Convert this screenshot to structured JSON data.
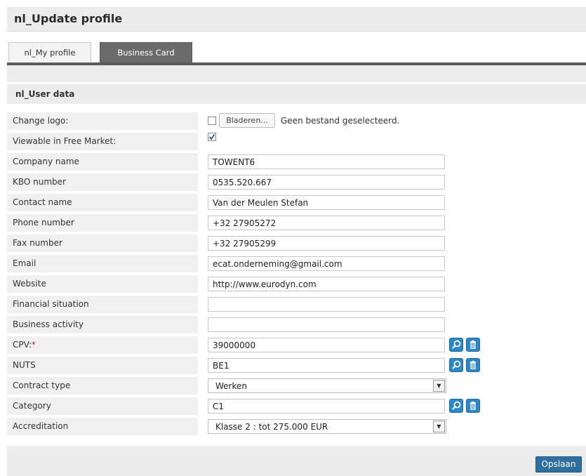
{
  "page": {
    "title": "nl_Update profile"
  },
  "tabs": [
    {
      "label": "nl_My profile"
    },
    {
      "label": "Business Card"
    }
  ],
  "section": {
    "title": "nl_User data"
  },
  "form": {
    "change_logo": {
      "label": "Change logo:",
      "browse_label": "Bladeren...",
      "no_file_text": "Geen bestand geselecteerd."
    },
    "viewable": {
      "label": "Viewable in Free Market:",
      "checked": true
    },
    "company_name": {
      "label": "Company name",
      "value": "TOWENT6"
    },
    "kbo_number": {
      "label": "KBO number",
      "value": "0535.520.667"
    },
    "contact_name": {
      "label": "Contact name",
      "value": "Van der Meulen Stefan"
    },
    "phone_number": {
      "label": "Phone number",
      "value": "+32 27905272"
    },
    "fax_number": {
      "label": "Fax number",
      "value": "+32 27905299"
    },
    "email": {
      "label": "Email",
      "value": "ecat.onderneming@gmail.com"
    },
    "website": {
      "label": "Website",
      "value": "http://www.eurodyn.com"
    },
    "financial_situation": {
      "label": "Financial situation",
      "value": ""
    },
    "business_activity": {
      "label": "Business activity",
      "value": ""
    },
    "cpv": {
      "label": "CPV:",
      "required_mark": "*",
      "value": "39000000"
    },
    "nuts": {
      "label": "NUTS",
      "value": "BE1"
    },
    "contract_type": {
      "label": "Contract type",
      "selected": "Werken"
    },
    "category": {
      "label": "Category",
      "value": "C1"
    },
    "accreditation": {
      "label": "Accreditation",
      "selected": "Klasse 2 : tot 275.000 EUR"
    }
  },
  "footer": {
    "save_label": "Opslaan"
  },
  "colors": {
    "accent": "#2d87c4",
    "save_button": "#2e6f9f",
    "tab_active": "#6b6b6b",
    "required": "#e02020"
  },
  "icons": {
    "search": "search-icon",
    "delete": "trash-icon"
  }
}
